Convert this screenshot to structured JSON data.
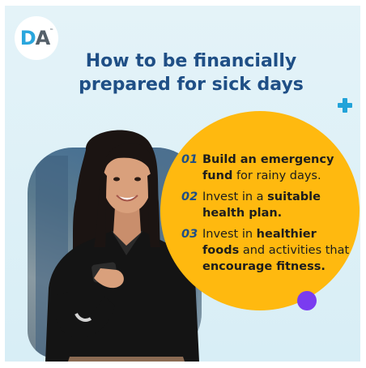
{
  "logo": {
    "d": "D",
    "a": "A",
    "tm": "™"
  },
  "title": {
    "line1": "How to be financially",
    "line2": "prepared for sick days"
  },
  "tips": [
    {
      "num": "01",
      "parts": [
        {
          "b": "Build an emergency"
        },
        {
          "t": " "
        },
        {
          "b": "fund"
        },
        {
          "t": " for rainy days."
        }
      ]
    },
    {
      "num": "02",
      "parts": [
        {
          "t": "Invest in a "
        },
        {
          "b": "suitable health plan."
        }
      ]
    },
    {
      "num": "03",
      "parts": [
        {
          "t": "Invest in "
        },
        {
          "b": "healthier foods"
        },
        {
          "t": " and activities that "
        },
        {
          "b": "encourage fitness."
        }
      ]
    }
  ],
  "colors": {
    "brand_blue": "#1f4f86",
    "accent_cyan": "#22a3d9",
    "circle_yellow": "#ffb90f",
    "dot_purple": "#7a3cf0",
    "background": "#e4f3f8"
  },
  "icons": [
    "plus-icon"
  ]
}
